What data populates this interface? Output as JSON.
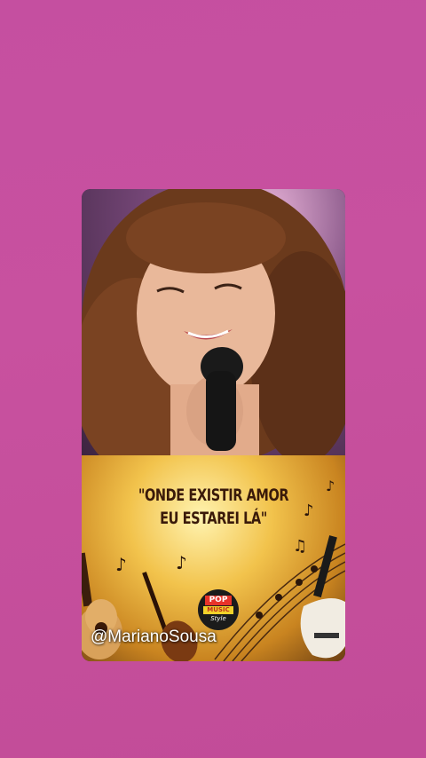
{
  "quote": {
    "line1": "\"ONDE EXISTIR AMOR",
    "line2": "EU ESTAREI LÁ\""
  },
  "logo": {
    "pop": "POP",
    "music": "MUSIC",
    "style": "Style"
  },
  "watermark": {
    "handle": "@MarianoSousa"
  },
  "colors": {
    "background": "#c8519f",
    "quote_text": "#3a1a0a"
  }
}
